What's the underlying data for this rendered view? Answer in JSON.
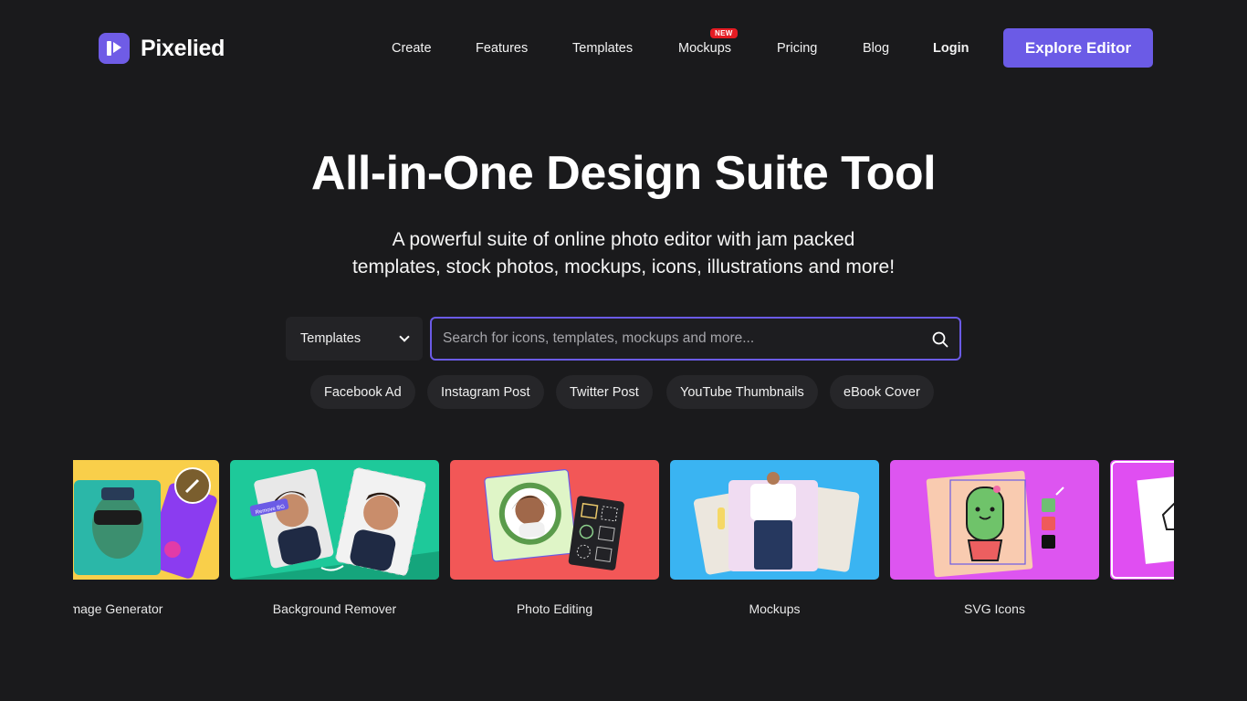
{
  "brand": {
    "name": "Pixelied",
    "accent": "#6b5be6"
  },
  "nav": {
    "items": [
      "Create",
      "Features",
      "Templates",
      "Mockups",
      "Pricing",
      "Blog"
    ],
    "new_badge": "NEW",
    "login": "Login",
    "cta": "Explore Editor"
  },
  "hero": {
    "title": "All-in-One Design Suite Tool",
    "subtitle_line1": "A powerful suite of online photo editor with jam packed",
    "subtitle_line2": "templates, stock photos, mockups, icons, illustrations and more!"
  },
  "search": {
    "category": "Templates",
    "placeholder": "Search for icons, templates, mockups and more..."
  },
  "chips": [
    "Facebook Ad",
    "Instagram Post",
    "Twitter Post",
    "YouTube Thumbnails",
    "eBook Cover"
  ],
  "cards": [
    {
      "label": "Image Generator",
      "color": "#f9cf4a"
    },
    {
      "label": "Background Remover",
      "color": "#1ec99a"
    },
    {
      "label": "Photo Editing",
      "color": "#f25757"
    },
    {
      "label": "Mockups",
      "color": "#3ab4f2"
    },
    {
      "label": "SVG Icons",
      "color": "#dd55f0"
    },
    {
      "label": "",
      "color": "#e04ef2"
    }
  ],
  "card_tags": {
    "remove_bg": "Remove BG"
  }
}
